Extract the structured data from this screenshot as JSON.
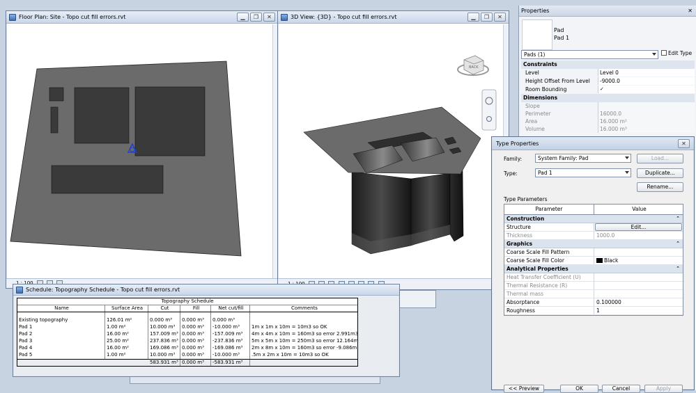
{
  "floor_plan": {
    "title": "Floor Plan: Site - Topo cut fill errors.rvt",
    "scale": "1 : 100"
  },
  "view3d": {
    "title": "3D View: {3D} - Topo cut fill errors.rvt",
    "scale": "1 : 100",
    "viewcube_label": "BACK"
  },
  "properties": {
    "title": "Properties",
    "type_name": "Pad",
    "type_sub": "Pad 1",
    "selector": "Pads (1)",
    "edit_type": "Edit Type",
    "groups": [
      {
        "name": "Constraints",
        "rows": [
          {
            "k": "Level",
            "v": "Level 0"
          },
          {
            "k": "Height Offset From Level",
            "v": "-9000.0"
          },
          {
            "k": "Room Bounding",
            "v": "✓"
          }
        ]
      },
      {
        "name": "Dimensions",
        "rows": [
          {
            "k": "Slope",
            "v": ""
          },
          {
            "k": "Perimeter",
            "v": "16000.0"
          },
          {
            "k": "Area",
            "v": "16.000 m²"
          },
          {
            "k": "Volume",
            "v": "16.000 m³"
          }
        ]
      }
    ]
  },
  "type_properties": {
    "title": "Type Properties",
    "family_label": "Family:",
    "family_value": "System Family: Pad",
    "type_label": "Type:",
    "type_value": "Pad 1",
    "load_btn": "Load...",
    "duplicate_btn": "Duplicate...",
    "rename_btn": "Rename...",
    "section_label": "Type Parameters",
    "col_param": "Parameter",
    "col_value": "Value",
    "groups": [
      {
        "name": "Construction",
        "rows": [
          {
            "p": "Structure",
            "v": "Edit...",
            "btn": true
          },
          {
            "p": "Thickness",
            "v": "1000.0",
            "grey": true
          }
        ]
      },
      {
        "name": "Graphics",
        "rows": [
          {
            "p": "Coarse Scale Fill Pattern",
            "v": ""
          },
          {
            "p": "Coarse Scale Fill Color",
            "v": "Black",
            "swatch": "#000000"
          }
        ]
      },
      {
        "name": "Analytical Properties",
        "rows": [
          {
            "p": "Heat Transfer Coefficient (U)",
            "v": "",
            "grey": true
          },
          {
            "p": "Thermal Resistance (R)",
            "v": "",
            "grey": true
          },
          {
            "p": "Thermal mass",
            "v": "",
            "grey": true
          },
          {
            "p": "Absorptance",
            "v": "0.100000"
          },
          {
            "p": "Roughness",
            "v": "1"
          }
        ]
      }
    ],
    "preview_btn": "<< Preview",
    "ok_btn": "OK",
    "cancel_btn": "Cancel",
    "apply_btn": "Apply"
  },
  "schedule": {
    "title": "Schedule: Topography Schedule - Topo cut fill errors.rvt",
    "table_title": "Topography Schedule",
    "columns": [
      "Name",
      "Surface Area",
      "Cut",
      "Fill",
      "Net cut/fill",
      "Comments"
    ],
    "rows": [
      [
        "Existing topography",
        "126.01 m²",
        "0.000 m³",
        "0.000 m³",
        "0.000 m³",
        ""
      ],
      [
        "Pad 1",
        "1.00 m²",
        "10.000 m³",
        "0.000 m³",
        "-10.000 m³",
        "1m x 1m x 10m = 10m3 so OK"
      ],
      [
        "Pad 2",
        "16.00 m²",
        "157.009 m³",
        "0.000 m³",
        "-157.009 m³",
        "4m x 4m x 10m = 160m3 so error 2.991m3"
      ],
      [
        "Pad 3",
        "25.00 m²",
        "237.836 m³",
        "0.000 m³",
        "-237.836 m³",
        "5m x 5m x 10m = 250m3 so error 12.164m3"
      ],
      [
        "Pad 4",
        "16.00 m²",
        "169.086 m³",
        "0.000 m³",
        "-169.086 m³",
        "2m x 8m x 10m = 160m3 so error -9.086m3"
      ],
      [
        "Pad 5",
        "1.00 m²",
        "10.000 m³",
        "0.000 m³",
        "-10.000 m³",
        ".5m x 2m x 10m = 10m3 so OK"
      ]
    ],
    "totals": [
      "",
      "",
      "583.931 m³",
      "0.000 m³",
      "-583.931 m³",
      ""
    ]
  },
  "colors": {
    "topo": "#6b6b6b",
    "pad": "#3a3a3a",
    "window_bg": "#c8d3e2"
  }
}
